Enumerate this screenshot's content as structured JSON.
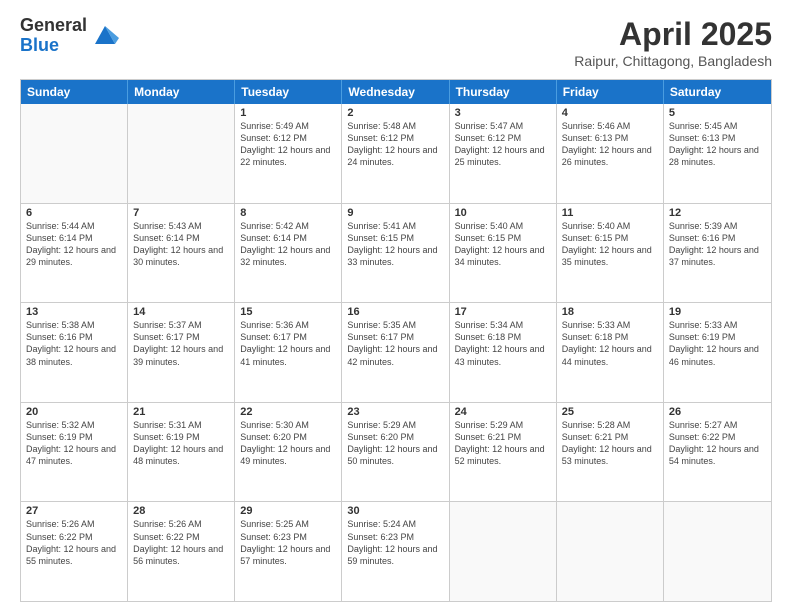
{
  "logo": {
    "general": "General",
    "blue": "Blue"
  },
  "title": "April 2025",
  "location": "Raipur, Chittagong, Bangladesh",
  "days": [
    "Sunday",
    "Monday",
    "Tuesday",
    "Wednesday",
    "Thursday",
    "Friday",
    "Saturday"
  ],
  "weeks": [
    [
      {
        "day": "",
        "info": ""
      },
      {
        "day": "",
        "info": ""
      },
      {
        "day": "1",
        "info": "Sunrise: 5:49 AM\nSunset: 6:12 PM\nDaylight: 12 hours and 22 minutes."
      },
      {
        "day": "2",
        "info": "Sunrise: 5:48 AM\nSunset: 6:12 PM\nDaylight: 12 hours and 24 minutes."
      },
      {
        "day": "3",
        "info": "Sunrise: 5:47 AM\nSunset: 6:12 PM\nDaylight: 12 hours and 25 minutes."
      },
      {
        "day": "4",
        "info": "Sunrise: 5:46 AM\nSunset: 6:13 PM\nDaylight: 12 hours and 26 minutes."
      },
      {
        "day": "5",
        "info": "Sunrise: 5:45 AM\nSunset: 6:13 PM\nDaylight: 12 hours and 28 minutes."
      }
    ],
    [
      {
        "day": "6",
        "info": "Sunrise: 5:44 AM\nSunset: 6:14 PM\nDaylight: 12 hours and 29 minutes."
      },
      {
        "day": "7",
        "info": "Sunrise: 5:43 AM\nSunset: 6:14 PM\nDaylight: 12 hours and 30 minutes."
      },
      {
        "day": "8",
        "info": "Sunrise: 5:42 AM\nSunset: 6:14 PM\nDaylight: 12 hours and 32 minutes."
      },
      {
        "day": "9",
        "info": "Sunrise: 5:41 AM\nSunset: 6:15 PM\nDaylight: 12 hours and 33 minutes."
      },
      {
        "day": "10",
        "info": "Sunrise: 5:40 AM\nSunset: 6:15 PM\nDaylight: 12 hours and 34 minutes."
      },
      {
        "day": "11",
        "info": "Sunrise: 5:40 AM\nSunset: 6:15 PM\nDaylight: 12 hours and 35 minutes."
      },
      {
        "day": "12",
        "info": "Sunrise: 5:39 AM\nSunset: 6:16 PM\nDaylight: 12 hours and 37 minutes."
      }
    ],
    [
      {
        "day": "13",
        "info": "Sunrise: 5:38 AM\nSunset: 6:16 PM\nDaylight: 12 hours and 38 minutes."
      },
      {
        "day": "14",
        "info": "Sunrise: 5:37 AM\nSunset: 6:17 PM\nDaylight: 12 hours and 39 minutes."
      },
      {
        "day": "15",
        "info": "Sunrise: 5:36 AM\nSunset: 6:17 PM\nDaylight: 12 hours and 41 minutes."
      },
      {
        "day": "16",
        "info": "Sunrise: 5:35 AM\nSunset: 6:17 PM\nDaylight: 12 hours and 42 minutes."
      },
      {
        "day": "17",
        "info": "Sunrise: 5:34 AM\nSunset: 6:18 PM\nDaylight: 12 hours and 43 minutes."
      },
      {
        "day": "18",
        "info": "Sunrise: 5:33 AM\nSunset: 6:18 PM\nDaylight: 12 hours and 44 minutes."
      },
      {
        "day": "19",
        "info": "Sunrise: 5:33 AM\nSunset: 6:19 PM\nDaylight: 12 hours and 46 minutes."
      }
    ],
    [
      {
        "day": "20",
        "info": "Sunrise: 5:32 AM\nSunset: 6:19 PM\nDaylight: 12 hours and 47 minutes."
      },
      {
        "day": "21",
        "info": "Sunrise: 5:31 AM\nSunset: 6:19 PM\nDaylight: 12 hours and 48 minutes."
      },
      {
        "day": "22",
        "info": "Sunrise: 5:30 AM\nSunset: 6:20 PM\nDaylight: 12 hours and 49 minutes."
      },
      {
        "day": "23",
        "info": "Sunrise: 5:29 AM\nSunset: 6:20 PM\nDaylight: 12 hours and 50 minutes."
      },
      {
        "day": "24",
        "info": "Sunrise: 5:29 AM\nSunset: 6:21 PM\nDaylight: 12 hours and 52 minutes."
      },
      {
        "day": "25",
        "info": "Sunrise: 5:28 AM\nSunset: 6:21 PM\nDaylight: 12 hours and 53 minutes."
      },
      {
        "day": "26",
        "info": "Sunrise: 5:27 AM\nSunset: 6:22 PM\nDaylight: 12 hours and 54 minutes."
      }
    ],
    [
      {
        "day": "27",
        "info": "Sunrise: 5:26 AM\nSunset: 6:22 PM\nDaylight: 12 hours and 55 minutes."
      },
      {
        "day": "28",
        "info": "Sunrise: 5:26 AM\nSunset: 6:22 PM\nDaylight: 12 hours and 56 minutes."
      },
      {
        "day": "29",
        "info": "Sunrise: 5:25 AM\nSunset: 6:23 PM\nDaylight: 12 hours and 57 minutes."
      },
      {
        "day": "30",
        "info": "Sunrise: 5:24 AM\nSunset: 6:23 PM\nDaylight: 12 hours and 59 minutes."
      },
      {
        "day": "",
        "info": ""
      },
      {
        "day": "",
        "info": ""
      },
      {
        "day": "",
        "info": ""
      }
    ]
  ]
}
